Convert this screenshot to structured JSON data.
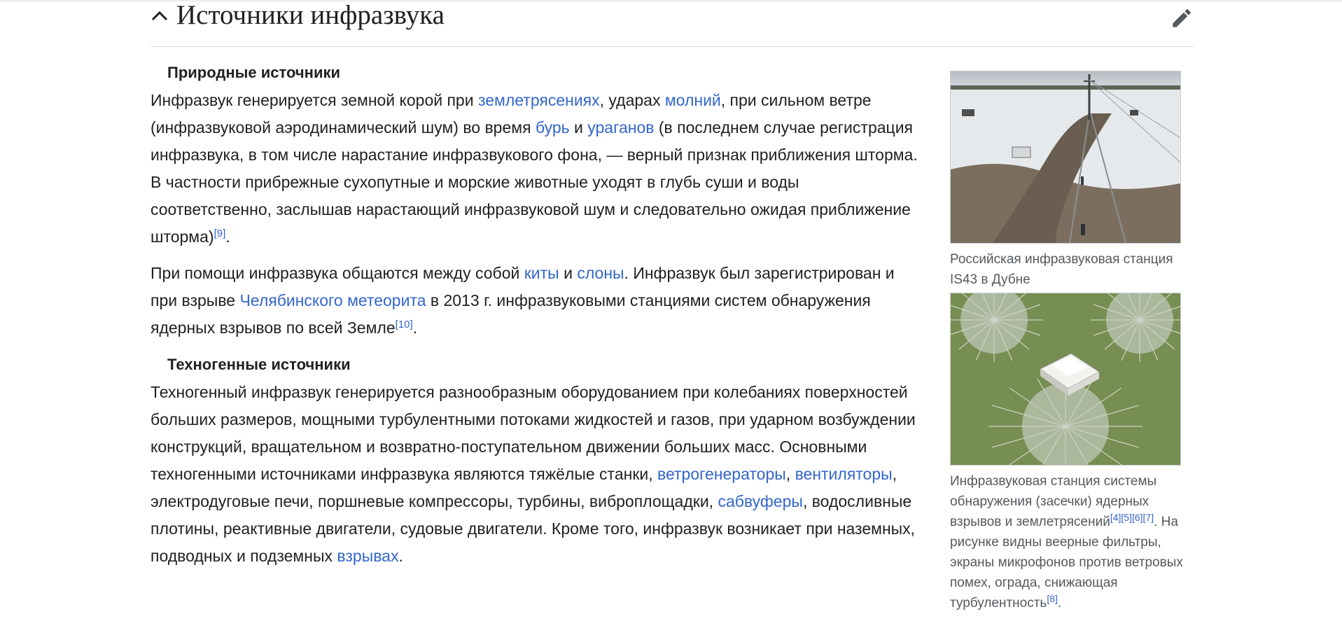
{
  "section": {
    "title": "Источники инфразвука",
    "collapse_icon": "chevron-up-icon",
    "edit_icon": "pencil-icon"
  },
  "natural": {
    "heading": "Природные источники",
    "p1": {
      "t1": "Инфразвук генерируется земной корой при ",
      "l1": "землетрясениях",
      "t2": ", ударах ",
      "l2": "молний",
      "t3": ", при сильном ветре (инфразвуковой аэродинамический шум) во время ",
      "l3": "бурь",
      "t4": " и ",
      "l4": "ураганов",
      "t5": " (в последнем случае регистрация инфразвука, в том числе нарастание инфразвукового фона, — верный признак приближения шторма. В частности прибрежные сухопутные и морские животные уходят в глубь суши и воды соответственно, заслышав нарастающий инфразвуковой шум и следовательно ожидая приближение шторма)",
      "ref": "[9]",
      "end": "."
    },
    "p2": {
      "t1": "При помощи инфразвука общаются между собой ",
      "l1": "киты",
      "t2": " и ",
      "l2": "слоны",
      "t3": ". Инфразвук был зарегистрирован и при взрыве ",
      "l3": "Челябинского метеорита",
      "t4": " в 2013 г. инфразвуковыми станциями систем обнаружения ядерных взрывов по всей Земле",
      "ref": "[10]",
      "end": "."
    }
  },
  "technogenic": {
    "heading": "Техногенные источники",
    "p1": {
      "t1": "Техногенный инфразвук генерируется разнообразным оборудованием при колебаниях поверхностей больших размеров, мощными турбулентными потоками жидкостей и газов, при ударном возбуждении конструкций, вращательном и возвратно-поступательном движении больших масс. Основными техногенными источниками инфразвука являются тяжёлые станки, ",
      "l1": "ветрогенераторы",
      "t2": ", ",
      "l2": "вентиляторы",
      "t3": ", электродуговые печи, поршневые компрессоры, турбины, виброплощадки, ",
      "l3": "сабвуферы",
      "t4": ", водосливные плотины, реактивные двигатели, судовые двигатели. Кроме того, инфразвук возникает при наземных, подводных и подземных ",
      "l4": "взрывах",
      "end": "."
    }
  },
  "thumbs": {
    "first": {
      "caption": "Российская инфразвуковая станция IS43 в Дубне"
    },
    "second": {
      "caption_t1": "Инфразвуковая станция системы обнаружения (засечки) ядерных взрывов и землетрясений",
      "refs1": [
        "[4]",
        "[5]",
        "[6]",
        "[7]"
      ],
      "caption_t2": ". На рисунке видны веерные фильтры, экраны микрофонов против ветровых помех, ограда, снижающая турбулентность",
      "ref2": "[8]",
      "end": "."
    }
  },
  "colors": {
    "link": "#3366cc",
    "text": "#202122",
    "caption": "#54595d"
  }
}
